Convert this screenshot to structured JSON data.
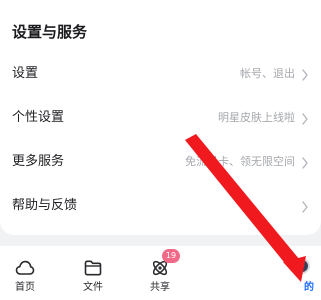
{
  "section": {
    "title": "设置与服务"
  },
  "rows": [
    {
      "label": "设置",
      "value": "帐号、退出"
    },
    {
      "label": "个性设置",
      "value": "明星皮肤上线啦"
    },
    {
      "label": "更多服务",
      "value": "免流量卡、领无限空间"
    },
    {
      "label": "帮助与反馈",
      "value": ""
    }
  ],
  "tabbar": {
    "home": {
      "label": "首页",
      "icon": "cloud-icon"
    },
    "files": {
      "label": "文件",
      "icon": "folder-icon"
    },
    "share": {
      "label": "共享",
      "icon": "atom-icon",
      "badge": "19"
    },
    "me": {
      "label": "的",
      "icon": "avatar"
    }
  },
  "colors": {
    "accent": "#1e6cff",
    "badge": "#f06a87",
    "annotation_arrow": "#f0191e",
    "background": "#f1f2f4",
    "card": "#ffffff"
  }
}
